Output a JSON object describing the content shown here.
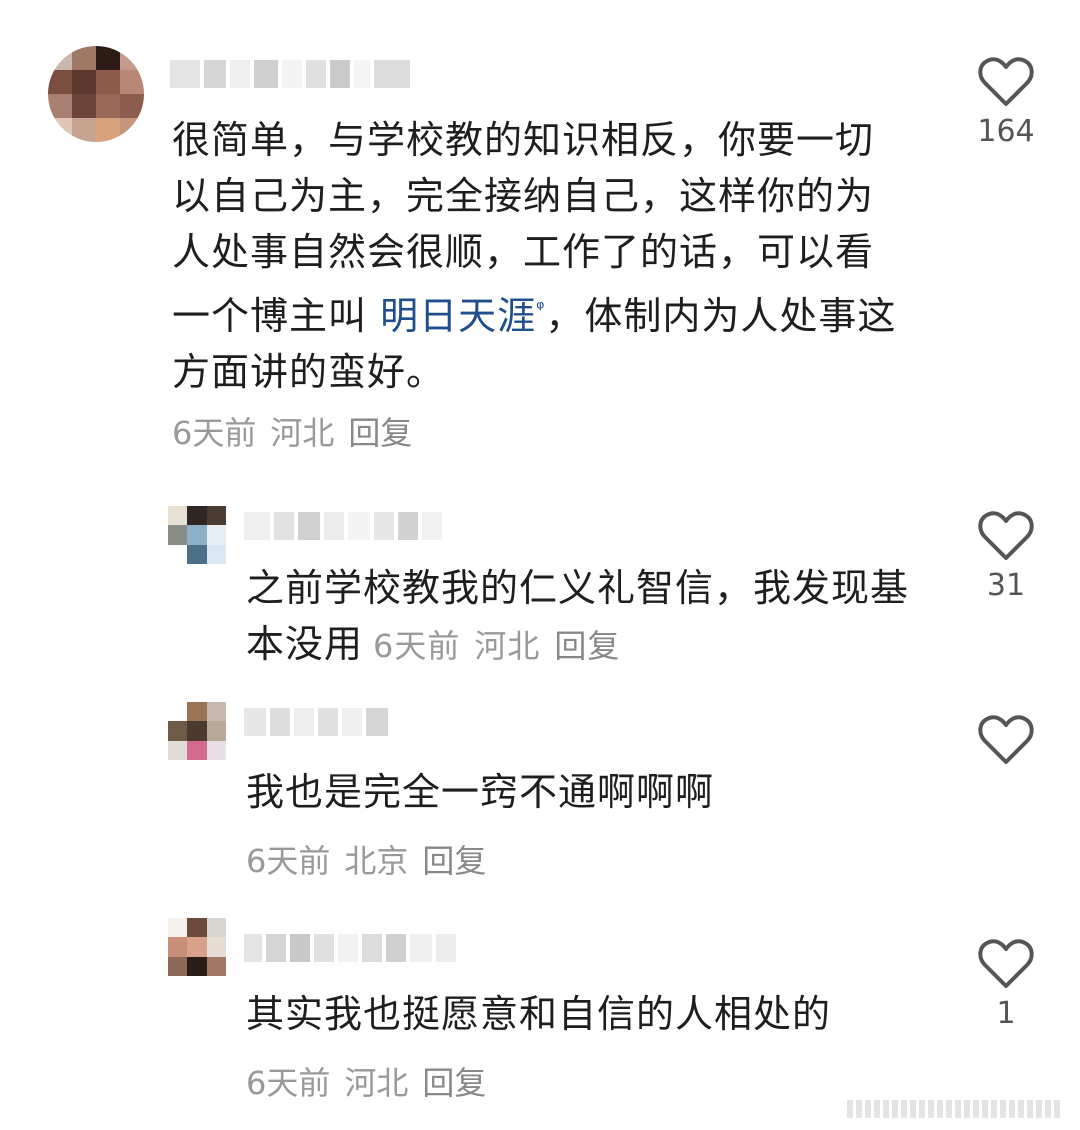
{
  "comments": [
    {
      "text_parts": [
        "很简单，与学校教的知识相反，你要一切以自己为主，完全接纳自己，这样你的为人处事自然会很顺，工作了的话，可以看一个博主叫 ",
        "明日天涯",
        "，体制内为人处事这方面讲的蛮好。"
      ],
      "search_icon": "search-icon",
      "time": "6天前",
      "location": "河北",
      "reply_label": "回复",
      "likes": "164"
    },
    {
      "text": "之前学校教我的仁义礼智信，我发现基本没用",
      "time": "6天前",
      "location": "河北",
      "reply_label": "回复",
      "likes": "31"
    },
    {
      "text": "我也是完全一窍不通啊啊啊",
      "time": "6天前",
      "location": "北京",
      "reply_label": "回复",
      "likes": ""
    },
    {
      "text": "其实我也挺愿意和自信的人相处的",
      "time": "6天前",
      "location": "河北",
      "reply_label": "回复",
      "likes": "1"
    }
  ],
  "like_icon": "heart-outline-icon",
  "colors": {
    "text": "#1e1e1e",
    "meta": "#999999",
    "link": "#1f4e8c",
    "icon": "#555555"
  }
}
